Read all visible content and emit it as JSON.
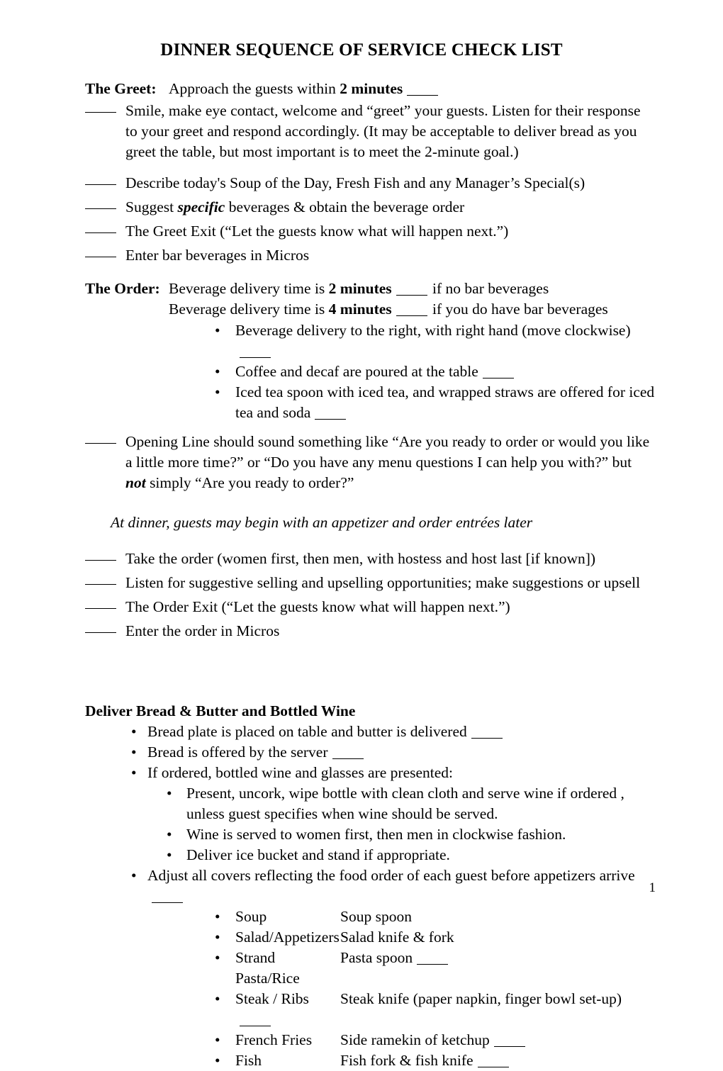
{
  "document": {
    "title": "DINNER SEQUENCE OF SERVICE CHECK LIST",
    "page_number": "1"
  },
  "greet": {
    "label": "The Greet",
    "label_colon": ":",
    "head_pre": "Approach the guests within ",
    "head_bold": "2 minutes",
    "items": [
      "Smile, make eye contact, welcome and “greet” your guests.  Listen for their response to your greet and respond accordingly.  (It may be acceptable to deliver bread as you greet the table, but most important is to meet the 2-minute goal.)",
      "Describe today's Soup of the Day, Fresh Fish and any Manager’s Special(s)",
      "The Greet Exit  (“Let the guests know what will happen next.”)",
      "Enter bar beverages in Micros"
    ],
    "suggest_pre": "Suggest ",
    "suggest_emph": "specific",
    "suggest_post": " beverages & obtain the beverage order"
  },
  "order": {
    "label": "The Order",
    "label_colon": ":",
    "line1_pre": "Beverage delivery time is ",
    "line1_bold": "2 minutes",
    "line1_post": "if no bar beverages",
    "line2_pre": "Beverage delivery time is ",
    "line2_bold": "4 minutes",
    "line2_post": "if you do have bar beverages",
    "bullets": [
      {
        "text": "Beverage delivery to the right, with right hand (move clockwise)",
        "blank": true
      },
      {
        "text": "Coffee and decaf are poured at the table",
        "blank": true
      },
      {
        "text": "Iced tea spoon with iced tea, and wrapped straws are offered for iced tea and soda",
        "blank": true
      }
    ],
    "opening_line_pre": "Opening Line should sound something like “Are you ready to order or would you like a little more time?” or “Do you have any menu questions I can help you with?” but ",
    "opening_line_emph": "not",
    "opening_line_post": " simply “Are you ready to order?”",
    "italic_note": "At dinner, guests may begin with an appetizer and order entrées later",
    "items": [
      "Take the order  (women first, then men, with hostess and host last [if known])",
      "Listen for suggestive selling and upselling opportunities; make suggestions or upsell",
      "The Order Exit  (“Let the guests know what will happen next.”)",
      "Enter the order in Micros"
    ]
  },
  "bread": {
    "heading": "Deliver Bread & Butter and Bottled Wine",
    "bullets": [
      {
        "text": "Bread plate is placed on table and butter is delivered",
        "blank": true
      },
      {
        "text": "Bread is offered by the server",
        "blank": true
      },
      {
        "text": "If ordered, bottled wine and glasses are presented:",
        "blank": false
      }
    ],
    "sub_bullets": [
      {
        "text": "Present, uncork, wipe bottle with clean cloth and serve wine if ordered , unless guest specifies when wine should be served.",
        "blank": false
      },
      {
        "text": "Wine is served to women first, then men in clockwise fashion.",
        "blank": false
      },
      {
        "text": "Deliver ice bucket and stand if appropriate.",
        "blank": false
      }
    ],
    "adjust_covers": {
      "text": "Adjust all covers reflecting the food order of each guest before appetizers arrive",
      "blank": true
    },
    "courses": [
      {
        "course": "Soup",
        "utensil": "Soup spoon",
        "blank": false
      },
      {
        "course": "Salad/Appetizers",
        "utensil": "Salad knife & fork",
        "blank": false
      },
      {
        "course": "Strand Pasta/Rice",
        "utensil": "Pasta spoon",
        "blank": true
      },
      {
        "course": "Steak / Ribs",
        "utensil": "Steak knife (paper napkin, finger bowl set-up)",
        "blank": true
      },
      {
        "course": "French Fries",
        "utensil": "Side ramekin of ketchup",
        "blank": true
      },
      {
        "course": "Fish",
        "utensil": "Fish fork & fish knife",
        "blank": true
      }
    ]
  },
  "symbols": {
    "bullet": "•"
  }
}
